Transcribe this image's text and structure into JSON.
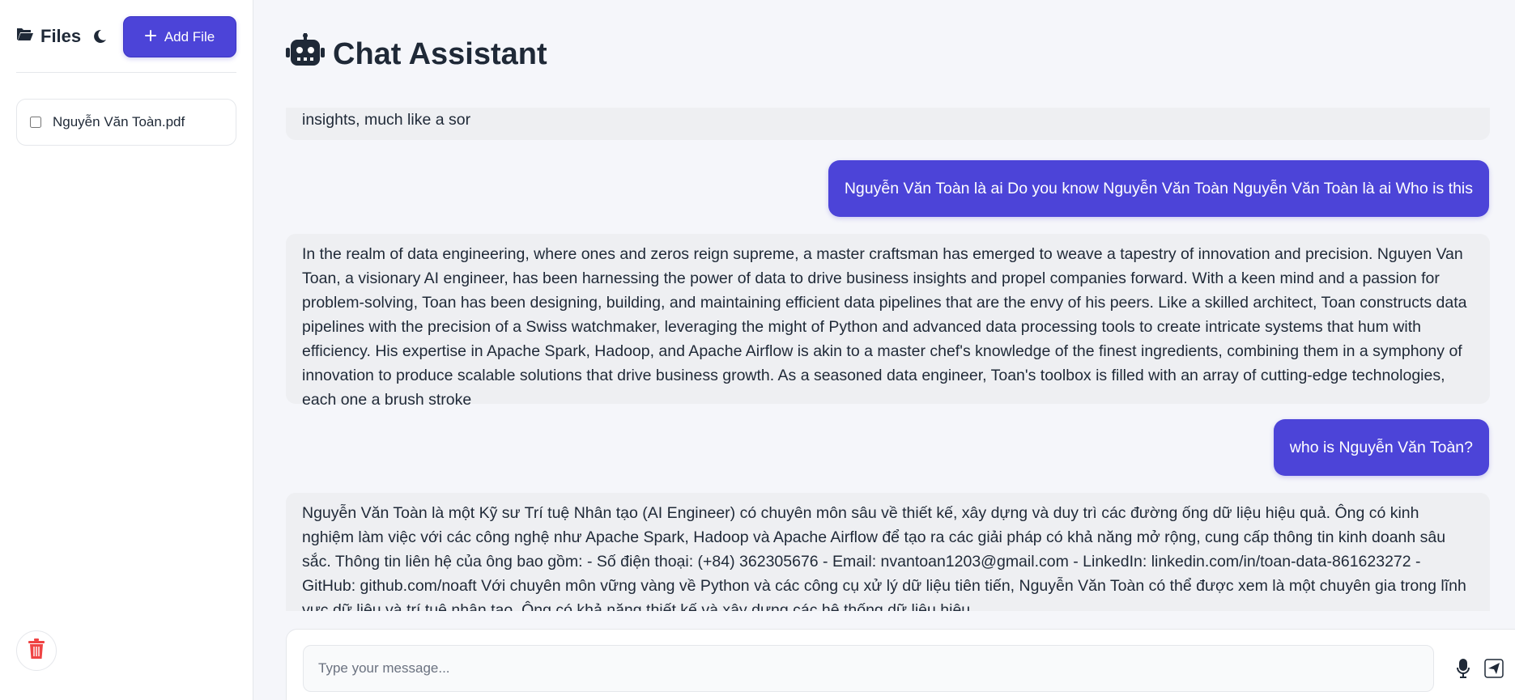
{
  "sidebar": {
    "title": "Files",
    "folder_icon": "folder-open-icon",
    "theme_icon": "moon-icon",
    "add_file_label": "Add File",
    "files": [
      {
        "name": "Nguyễn Văn Toàn.pdf",
        "checked": false
      }
    ],
    "trash_icon": "trash-icon"
  },
  "chat": {
    "title": "Chat Assistant",
    "title_icon": "robot-icon",
    "messages": [
      {
        "role": "bot",
        "text": "extensions of his creative genius, as he wields them with the skill of a master swordsman. With a wave of his hand, Toan conjures scalable solutions that drive business insights, much like a sor"
      },
      {
        "role": "user",
        "text": "Nguyễn Văn Toàn là ai Do you know Nguyễn Văn Toàn Nguyễn Văn Toàn là ai Who is this"
      },
      {
        "role": "bot",
        "text": "In the realm of data engineering, where ones and zeros reign supreme, a master craftsman has emerged to weave a tapestry of innovation and precision. Nguyen Van Toan, a visionary AI engineer, has been harnessing the power of data to drive business insights and propel companies forward. With a keen mind and a passion for problem-solving, Toan has been designing, building, and maintaining efficient data pipelines that are the envy of his peers. Like a skilled architect, Toan constructs data pipelines with the precision of a Swiss watchmaker, leveraging the might of Python and advanced data processing tools to create intricate systems that hum with efficiency. His expertise in Apache Spark, Hadoop, and Apache Airflow is akin to a master chef's knowledge of the finest ingredients, combining them in a symphony of innovation to produce scalable solutions that drive business growth. As a seasoned data engineer, Toan's toolbox is filled with an array of cutting-edge technologies, each one a brush stroke"
      },
      {
        "role": "user",
        "text": "who is Nguyễn Văn Toàn?"
      },
      {
        "role": "bot",
        "text": "Nguyễn Văn Toàn là một Kỹ sư Trí tuệ Nhân tạo (AI Engineer) có chuyên môn sâu về thiết kế, xây dựng và duy trì các đường ống dữ liệu hiệu quả. Ông có kinh nghiệm làm việc với các công nghệ như Apache Spark, Hadoop và Apache Airflow để tạo ra các giải pháp có khả năng mở rộng, cung cấp thông tin kinh doanh sâu sắc. Thông tin liên hệ của ông bao gồm: - Số điện thoại: (+84) 362305676 - Email: nvantoan1203@gmail.com - LinkedIn: linkedin.com/in/toan-data-861623272 - GitHub: github.com/noaft Với chuyên môn vững vàng về Python và các công cụ xử lý dữ liệu tiên tiến, Nguyễn Văn Toàn có thể được xem là một chuyên gia trong lĩnh vực dữ liệu và trí tuệ nhân tạo. Ông có khả năng thiết kế và xây dựng các hệ thống dữ liệu hiệu"
      }
    ],
    "input_placeholder": "Type your message...",
    "input_value": "",
    "mic_icon": "microphone-icon",
    "send_icon": "send-icon"
  },
  "colors": {
    "accent": "#4c44d8",
    "bot_bubble": "#eeeff2",
    "danger": "#ef4444"
  }
}
